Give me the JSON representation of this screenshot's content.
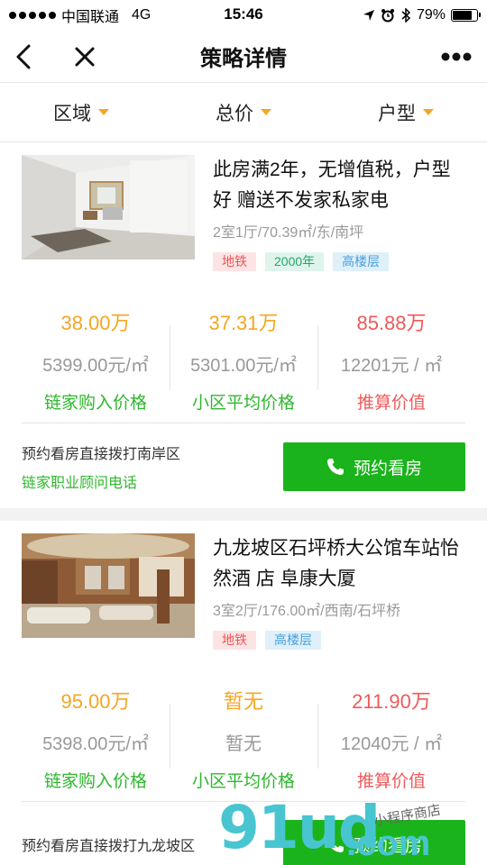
{
  "status": {
    "carrier": "中国联通",
    "network": "4G",
    "time": "15:46",
    "battery": "79%",
    "battery_level": 0.79
  },
  "nav": {
    "title": "策略详情",
    "back_icon": "chevron-left-icon",
    "close_icon": "close-icon",
    "more_icon": "more-dots-icon"
  },
  "filters": [
    {
      "label": "区域"
    },
    {
      "label": "总价"
    },
    {
      "label": "户型"
    }
  ],
  "colors": {
    "accent_orange": "#f5a623",
    "red": "#ee5a5a",
    "green": "#2eb82e",
    "button_green": "#1bb31b"
  },
  "listings": [
    {
      "title": "此房满2年，无增值税，户型好 赠送不发家私家电",
      "meta": "2室1厅/70.39㎡/东/南坪",
      "tags": [
        {
          "label": "地铁",
          "style": "red"
        },
        {
          "label": "2000年",
          "style": "green"
        },
        {
          "label": "高楼层",
          "style": "blue"
        }
      ],
      "prices": [
        {
          "main": "38.00万",
          "sub": "5399.00元/㎡",
          "label": "链家购入价格"
        },
        {
          "main": "37.31万",
          "sub": "5301.00元/㎡",
          "label": "小区平均价格"
        },
        {
          "main": "85.88万",
          "sub": "12201元 / ㎡",
          "label": "推算价值"
        }
      ],
      "contact_line1": "预约看房直接拨打南岸区",
      "contact_line2": "链家职业顾问电话",
      "button_label": "预约看房"
    },
    {
      "title": "九龙坡区石坪桥大公馆车站怡然酒 店 阜康大厦",
      "meta": "3室2厅/176.00㎡/西南/石坪桥",
      "tags": [
        {
          "label": "地铁",
          "style": "red"
        },
        {
          "label": "高楼层",
          "style": "blue"
        }
      ],
      "prices": [
        {
          "main": "95.00万",
          "sub": "5398.00元/㎡",
          "label": "链家购入价格"
        },
        {
          "main": "暂无",
          "sub": "暂无",
          "label": "小区平均价格"
        },
        {
          "main": "211.90万",
          "sub": "12040元 / ㎡",
          "label": "推算价值"
        }
      ],
      "contact_line1": "预约看房直接拨打九龙坡区",
      "button_label": "预约看房"
    }
  ],
  "watermark": {
    "brand": "91ud",
    "suffix": ".com",
    "tagline": "小程序商店"
  }
}
